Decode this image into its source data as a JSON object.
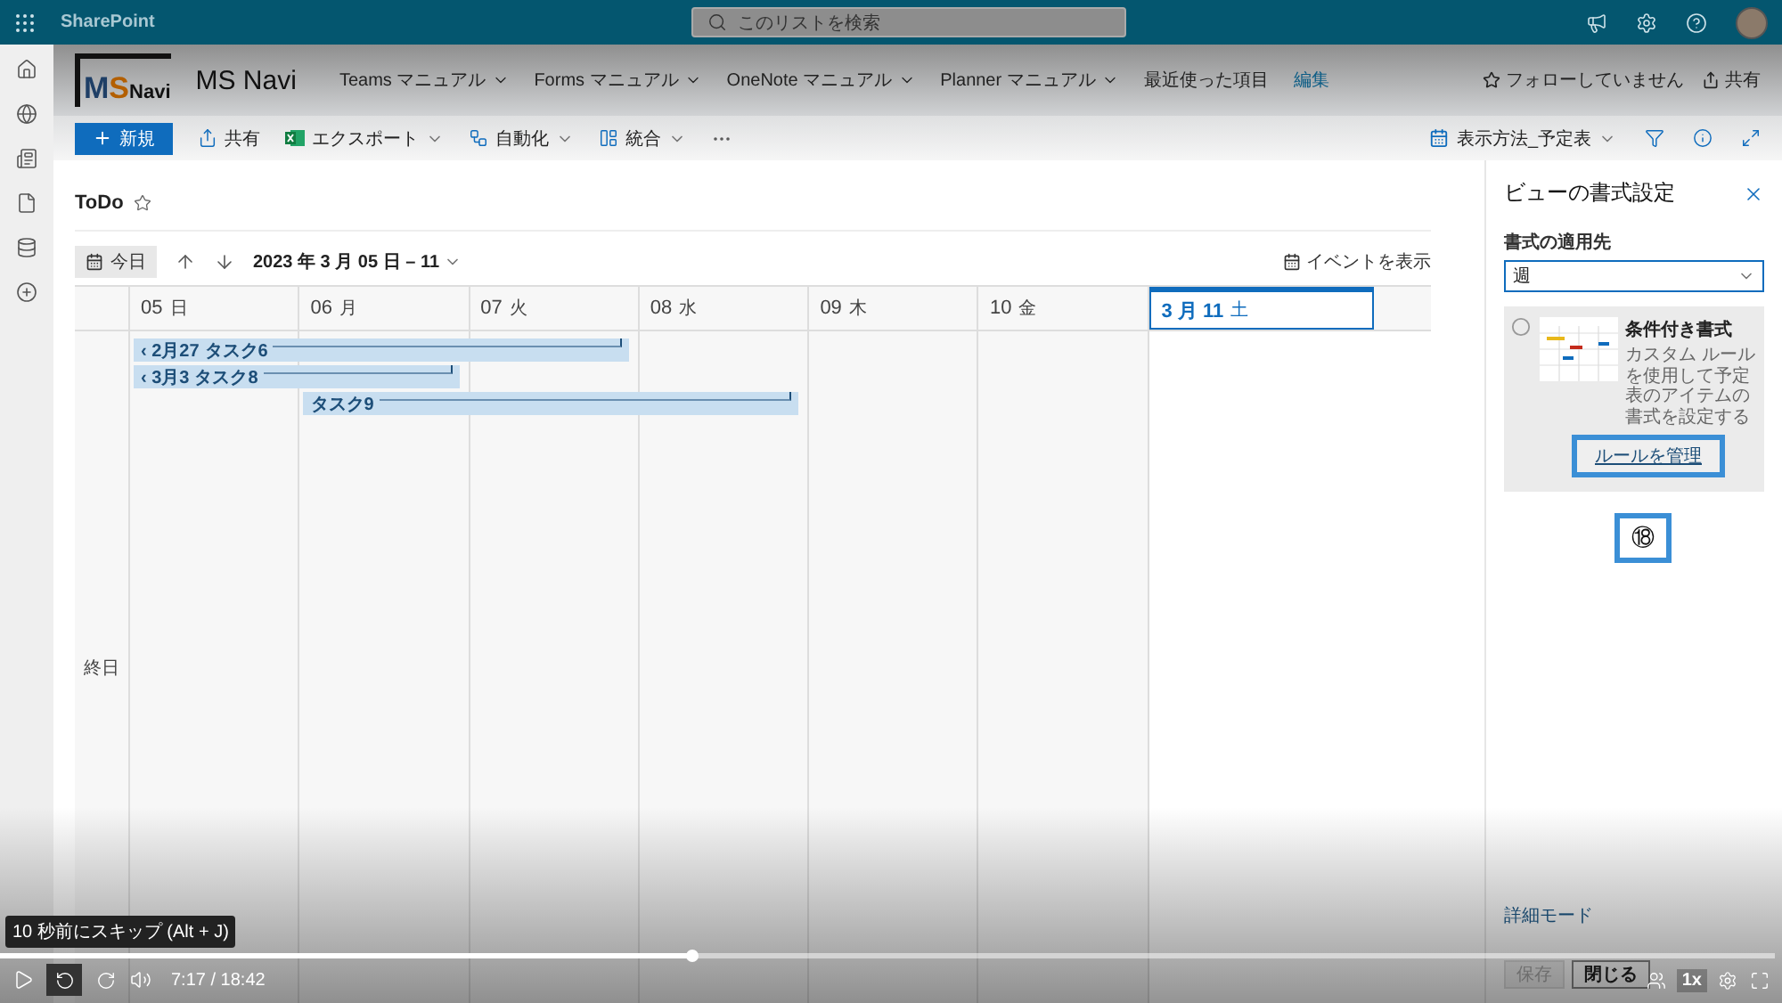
{
  "suite_bar": {
    "app_name": "SharePoint",
    "search_placeholder": "このリストを検索"
  },
  "site_header": {
    "logo_parts": [
      "M",
      "S",
      "Navi"
    ],
    "site_title": "MS Navi",
    "nav": [
      {
        "label": "Teams マニュアル",
        "dropdown": true,
        "kind": "menu"
      },
      {
        "label": "Forms マニュアル",
        "dropdown": true,
        "kind": "menu"
      },
      {
        "label": "OneNote マニュアル",
        "dropdown": true,
        "kind": "menu"
      },
      {
        "label": "Planner マニュアル",
        "dropdown": true,
        "kind": "menu"
      },
      {
        "label": "最近使った項目",
        "dropdown": false,
        "kind": "menu"
      },
      {
        "label": "編集",
        "dropdown": false,
        "kind": "link"
      }
    ],
    "follow": "フォローしていません",
    "share": "共有"
  },
  "command_bar": {
    "new": "新規",
    "items": [
      {
        "label": "共有",
        "kind": "share",
        "dropdown": false
      },
      {
        "label": "エクスポート",
        "kind": "excel",
        "dropdown": true
      },
      {
        "label": "自動化",
        "kind": "automate",
        "dropdown": true
      },
      {
        "label": "統合",
        "kind": "integrate",
        "dropdown": true
      }
    ],
    "view": "表示方法_予定表"
  },
  "list_title": "ToDo",
  "calendar": {
    "today": "今日",
    "range": "2023 年 3 月 05 日 – 11",
    "show_events": "イベントを表示",
    "all_day": "終日",
    "days": [
      {
        "date": "05",
        "weekday": "日",
        "selected": false
      },
      {
        "date": "06",
        "weekday": "月",
        "selected": false
      },
      {
        "date": "07",
        "weekday": "火",
        "selected": false
      },
      {
        "date": "08",
        "weekday": "水",
        "selected": false
      },
      {
        "date": "09",
        "weekday": "木",
        "selected": false
      },
      {
        "date": "10",
        "weekday": "金",
        "selected": false
      },
      {
        "date": "3 月 11",
        "weekday": "土",
        "selected": true
      }
    ],
    "events": [
      {
        "title": "タスク6",
        "start_label": "‹ 2月27",
        "covers": [
          true,
          true,
          true,
          false,
          false,
          false,
          false
        ]
      },
      {
        "title": "タスク8",
        "start_label": "‹ 3月3",
        "covers": [
          true,
          true,
          false,
          false,
          false,
          false,
          false
        ]
      },
      {
        "title": "タスク9",
        "covers": [
          false,
          true,
          true,
          true,
          false,
          false,
          false
        ]
      }
    ]
  },
  "format_panel": {
    "title": "ビューの書式設定",
    "apply_to_label": "書式の適用先",
    "apply_to_value": "週",
    "card": {
      "title": "条件付き書式",
      "description": "カスタム ルールを使用して予定表のアイテムの書式を設定する",
      "link": "ルールを管理",
      "checked": false
    },
    "callout": "⑱",
    "advanced_mode": "詳細モード",
    "buttons": [
      {
        "label": "保存",
        "disabled": true
      },
      {
        "label": "閉じる",
        "disabled": false
      }
    ]
  },
  "player": {
    "tooltip": "10 秒前にスキップ (Alt + J)",
    "progress": {
      "level": 0.39
    },
    "time": "7:17 / 18:42",
    "speed": "1x"
  }
}
